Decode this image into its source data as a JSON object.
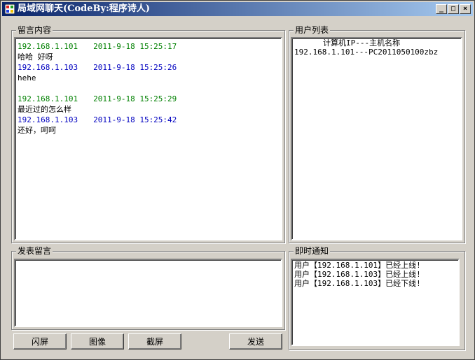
{
  "window": {
    "title": "局域网聊天(CodeBy:程序诗人)",
    "minimize": "_",
    "maximize": "□",
    "close": "×"
  },
  "messages_panel": {
    "label": "留言内容",
    "messages": [
      {
        "ip": "192.168.1.101",
        "time": "2011-9-18 15:25:17",
        "text": "哈哈 好呀",
        "color": "green"
      },
      {
        "ip": "192.168.1.103",
        "time": "2011-9-18 15:25:26",
        "text": "hehe",
        "color": "blue"
      },
      {
        "ip": "192.168.1.101",
        "time": "2011-9-18 15:25:29",
        "text": "最近过的怎么样",
        "color": "green"
      },
      {
        "ip": "192.168.1.103",
        "time": "2011-9-18 15:25:42",
        "text": "还好，呵呵",
        "color": "blue"
      }
    ]
  },
  "users_panel": {
    "label": "用户列表",
    "header": "计算机IP---主机名称",
    "users": [
      "192.168.1.101---PC2011050100zbz"
    ]
  },
  "compose_panel": {
    "label": "发表留言",
    "value": ""
  },
  "notify_panel": {
    "label": "即时通知",
    "notices": [
      "用户【192.168.1.101】已经上线!",
      "用户【192.168.1.103】已经上线!",
      "用户【192.168.1.103】已经下线!"
    ]
  },
  "buttons": {
    "flash": "闪屏",
    "image": "图像",
    "screenshot": "截屏",
    "send": "发送"
  },
  "colors": {
    "green": "#008000",
    "blue": "#0000c0",
    "titlebar_start": "#0a246a",
    "titlebar_end": "#a6caf0",
    "face": "#d4d0c8"
  }
}
